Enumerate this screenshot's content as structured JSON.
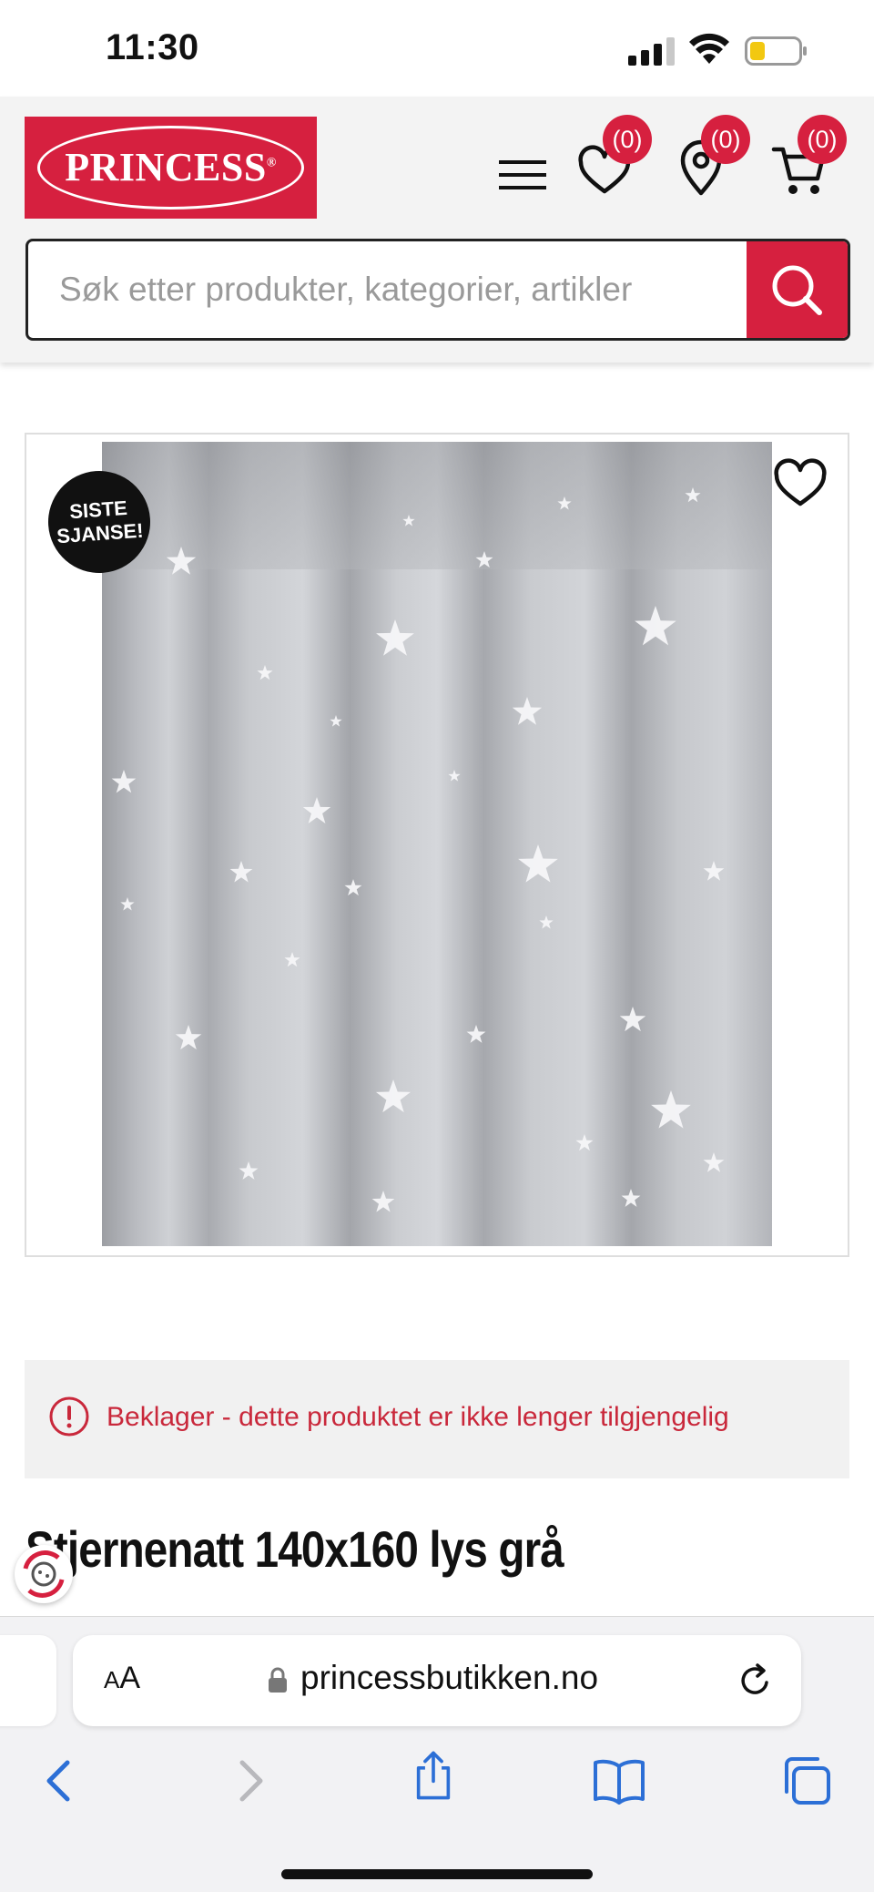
{
  "status_bar": {
    "time": "11:30"
  },
  "header": {
    "logo_text": "PRINCESS",
    "logo_mark": "®",
    "wishlist_count": "(0)",
    "stores_count": "(0)",
    "cart_count": "(0)",
    "brand_color": "#d6203f"
  },
  "search": {
    "placeholder": "Søk etter produkter, kategorier, artikler",
    "value": ""
  },
  "product": {
    "badge_line1": "SISTE",
    "badge_line2": "SJANSE!",
    "alert_text": "Beklager - dette produktet er ikke lenger tilgjengelig",
    "title": "Stjernenatt 140x160 lys grå",
    "image_description_icon": "curtain-image"
  },
  "browser": {
    "aa_small": "A",
    "aa_large": "A",
    "url": "princessbutikken.no"
  }
}
